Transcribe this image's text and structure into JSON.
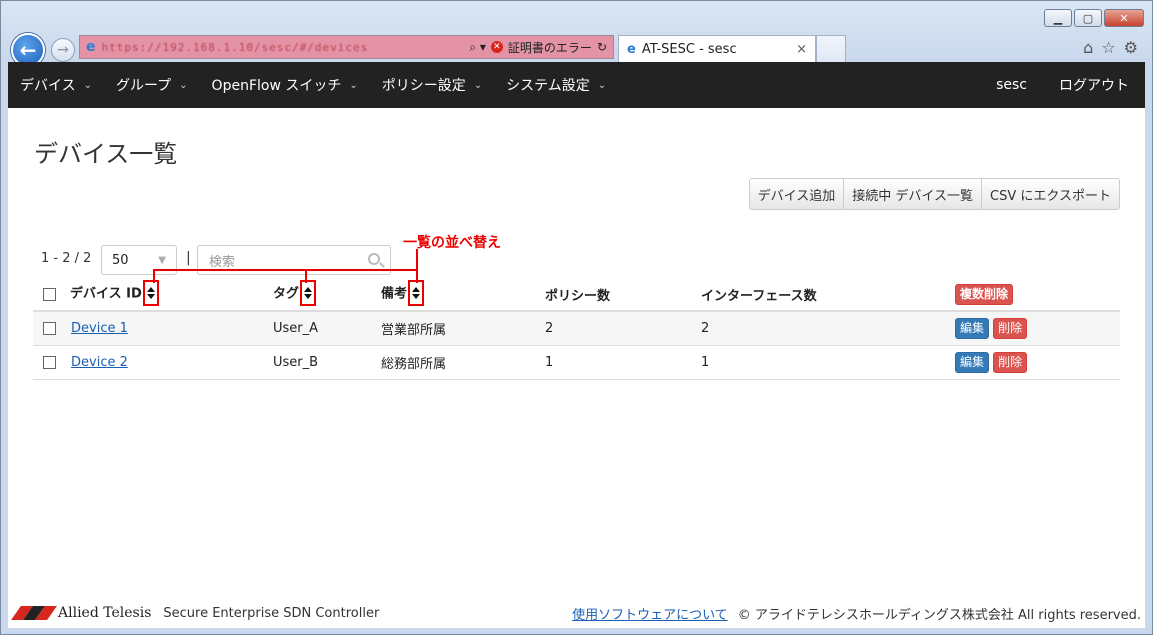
{
  "browser": {
    "address_url": "https://192.168.1.10/sesc/#/devices",
    "address_search_icon": "search-icon",
    "cert_error_text": "証明書のエラー",
    "tab_title": "AT-SESC - sesc",
    "tab_close": "×"
  },
  "nav": {
    "items": [
      {
        "label": "デバイス"
      },
      {
        "label": "グループ"
      },
      {
        "label": "OpenFlow スイッチ"
      },
      {
        "label": "ポリシー設定"
      },
      {
        "label": "システム設定"
      }
    ],
    "user": "sesc",
    "logout": "ログアウト",
    "caret": "⌄"
  },
  "page": {
    "title": "デバイス一覧",
    "actions": {
      "add": "デバイス追加",
      "connected": "接続中 デバイス一覧",
      "export": "CSV にエクスポート"
    },
    "range": "1 - 2 / 2",
    "page_size": "50",
    "separator": "|",
    "search_placeholder": "検索",
    "annotation": "一覧の並べ替え"
  },
  "table": {
    "headers": {
      "device_id": "デバイス ID",
      "tag": "タグ",
      "note": "備考",
      "policy_count": "ポリシー数",
      "interface_count": "インターフェース数",
      "bulk_delete": "複数削除"
    },
    "rows": [
      {
        "device_id": "Device 1",
        "tag": "User_A",
        "note": "営業部所属",
        "policy_count": "2",
        "interface_count": "2",
        "edit": "編集",
        "delete": "削除"
      },
      {
        "device_id": "Device 2",
        "tag": "User_B",
        "note": "総務部所属",
        "policy_count": "1",
        "interface_count": "1",
        "edit": "編集",
        "delete": "削除"
      }
    ]
  },
  "footer": {
    "brand": "Allied Telesis",
    "product": "Secure Enterprise SDN Controller",
    "software_link": "使用ソフトウェアについて",
    "copyright": "© アライドテレシスホールディングス株式会社 All rights reserved."
  },
  "colors": {
    "nav_bg": "#222222",
    "link": "#1a5fb4",
    "primary": "#337ab7",
    "danger": "#d9534f",
    "annotation": "#ee0000"
  }
}
